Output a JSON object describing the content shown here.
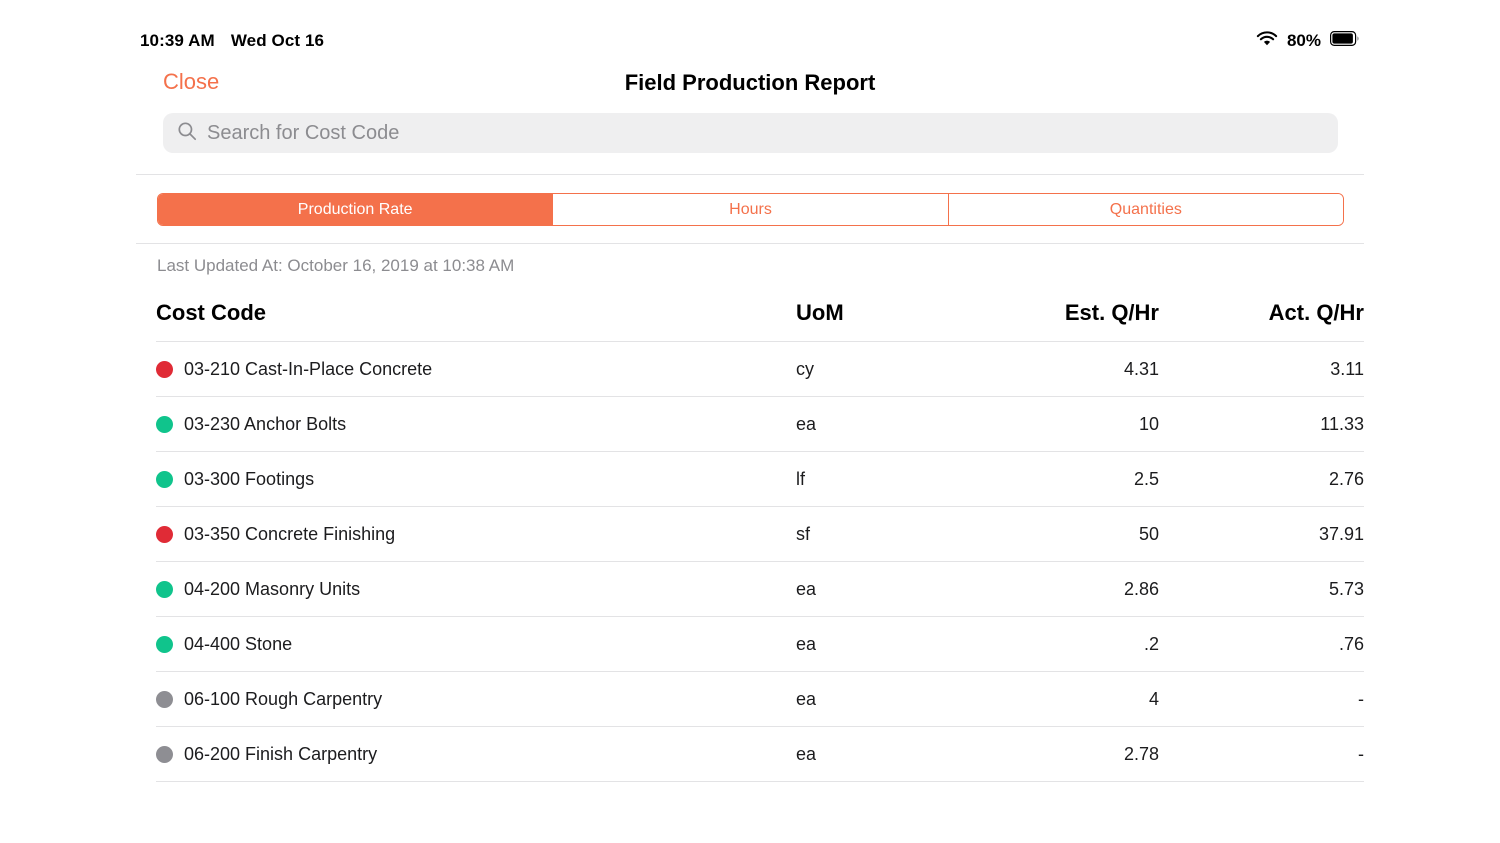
{
  "status_bar": {
    "time": "10:39 AM",
    "date": "Wed Oct 16",
    "battery_percent": "80%",
    "wifi_icon": "wifi-icon",
    "battery_icon": "battery-icon"
  },
  "nav": {
    "close_label": "Close",
    "title": "Field Production Report"
  },
  "search": {
    "placeholder": "Search for Cost Code",
    "value": "",
    "icon": "search-icon"
  },
  "segmented": {
    "options": [
      {
        "label": "Production Rate",
        "selected": true
      },
      {
        "label": "Hours",
        "selected": false
      },
      {
        "label": "Quantities",
        "selected": false
      }
    ]
  },
  "meta": {
    "last_updated": "Last Updated At: October 16, 2019 at 10:38 AM"
  },
  "colors": {
    "accent": "#F4714B",
    "status_red": "#E02B36",
    "status_green": "#10C48C",
    "status_gray": "#8E8E93",
    "divider": "#E3E3E5",
    "search_bg": "#EFEFF0",
    "placeholder_text": "#8C8C90"
  },
  "table": {
    "columns": [
      "Cost Code",
      "UoM",
      "Est. Q/Hr",
      "Act. Q/Hr"
    ],
    "rows": [
      {
        "status": "red",
        "cost_code": "03-210 Cast-In-Place Concrete",
        "uom": "cy",
        "est": "4.31",
        "act": "3.11"
      },
      {
        "status": "green",
        "cost_code": "03-230 Anchor Bolts",
        "uom": "ea",
        "est": "10",
        "act": "11.33"
      },
      {
        "status": "green",
        "cost_code": "03-300 Footings",
        "uom": "lf",
        "est": "2.5",
        "act": "2.76"
      },
      {
        "status": "red",
        "cost_code": "03-350 Concrete Finishing",
        "uom": "sf",
        "est": "50",
        "act": "37.91"
      },
      {
        "status": "green",
        "cost_code": "04-200 Masonry Units",
        "uom": "ea",
        "est": "2.86",
        "act": "5.73"
      },
      {
        "status": "green",
        "cost_code": "04-400 Stone",
        "uom": "ea",
        "est": ".2",
        "act": ".76"
      },
      {
        "status": "gray",
        "cost_code": "06-100 Rough Carpentry",
        "uom": "ea",
        "est": "4",
        "act": "-"
      },
      {
        "status": "gray",
        "cost_code": "06-200 Finish Carpentry",
        "uom": "ea",
        "est": "2.78",
        "act": "-"
      }
    ]
  }
}
